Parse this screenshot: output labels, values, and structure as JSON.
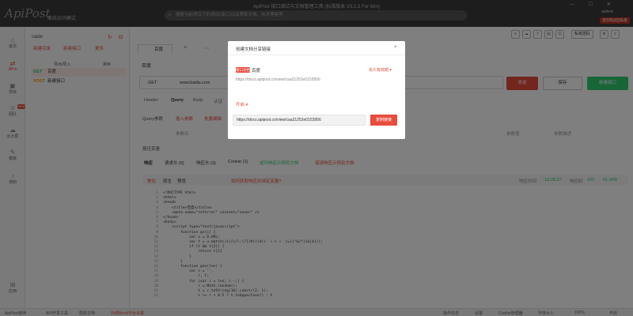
{
  "app": {
    "logo": "ApiPost",
    "offline_mode": "离线访问模式",
    "window_title": "ApiPost 接口调试与文档管理工具 (标准版本 V3.2.3 For Win)",
    "search_placeholder": "搜索当前项目下的项目(接口)以及帮助文档、技术博客等",
    "user": "apitest",
    "vip_badge": "提示购买团队版",
    "team_label": "私有团队"
  },
  "left_nav": [
    {
      "label": "首页",
      "icon": "home-icon"
    },
    {
      "label": "APIs",
      "icon": "api-icon"
    },
    {
      "label": "项目",
      "icon": "project-icon"
    },
    {
      "label": "团队",
      "icon": "team-icon",
      "badge": "NEW"
    },
    {
      "label": "云大屏",
      "icon": "cloud-icon"
    },
    {
      "label": "模板",
      "icon": "template-icon"
    },
    {
      "label": "通知",
      "icon": "bell-icon"
    },
    {
      "label": "应用",
      "icon": "apps-icon"
    }
  ],
  "tree": {
    "project": "caidx",
    "new_dir": "新建目录",
    "new_api": "新建接口",
    "more": "更多",
    "import_btn": "导出/导入",
    "filter_btn": "排序",
    "rows": [
      {
        "method": "GET",
        "name": "百度"
      },
      {
        "method": "POST",
        "name": "新建接口"
      }
    ]
  },
  "editor": {
    "tab": "百度",
    "crumb": "百度",
    "method": "GET",
    "url": "www.baidu.com",
    "send": "发送",
    "save": "保存",
    "new": "新建接口",
    "req_tabs": [
      "Header",
      "Query",
      "Body",
      "认证",
      "预执行脚本",
      "后执行脚本"
    ],
    "query_title": "Query参数",
    "query_add": "插入参数",
    "query_bulk": "批量编辑",
    "param_name": "参数名",
    "param_value": "参数值",
    "param_desc": "参数描述",
    "resp_title": "路径变量",
    "resp_tabs": [
      "响应",
      "请求头 (5)",
      "响应头 (3)",
      "Cookie (1)",
      "成功响应示例及文档",
      "错误响应示例及文档"
    ],
    "resp_tools": [
      "美化",
      "原生",
      "预览"
    ],
    "resp_hint": "如何获取响应并绑定变量?",
    "resp_time": "响应时间",
    "resp_time_val": "19.08.27",
    "status_code": "响应码",
    "status_val": "200",
    "size_val": "61.0KB"
  },
  "code_lines": [
    "<!DOCTYPE html>",
    "<html>",
    "<head>",
    "    <title>百度</title>",
    "    <meta name=\"referrer\" content=\"never\" />",
    "</head>",
    "<body>",
    "    <script type=\"text/javascript\">",
    "        function gs(c) {",
    "            var u = D.URL;",
    "            var t = u.match(/x([\\/\\:\\?](#)(\\d)(' + c + ')=([^&]*)(&|$)/);",
    "            if (t && t[2]) {",
    "                return t[2]",
    "            }",
    "        }",
    "        function gen(len) {",
    "            var s = '',",
    "                r, t;",
    "            for (var i = len; i--;) {",
    "                r = Math.random();",
    "                t = r.toString(16).substr(2, 1);",
    "                s += r > 0.5 ? t.toUpperCase() : t"
  ],
  "statusbar": {
    "left1": "ApiPost官网",
    "left2": "API开发工具",
    "left3": "帮助文档",
    "left4": "外部Mock平台设置",
    "r1": "操作日志",
    "r2": "设置",
    "r3": "Cookie管理器",
    "r4": "字体大小",
    "r5": "100%",
    "r6": "开启"
  },
  "modal": {
    "title": "创建文档分享链接",
    "tag": "接口文档",
    "name": "百度",
    "expire": "永久有效期",
    "url_preview": "https://docs.apipost.cn/view/caa21252e0153956",
    "open": "开启",
    "share_url": "https://docs.apipost.cn/view/caa21252e0153956",
    "copy_btn": "复制链接"
  }
}
